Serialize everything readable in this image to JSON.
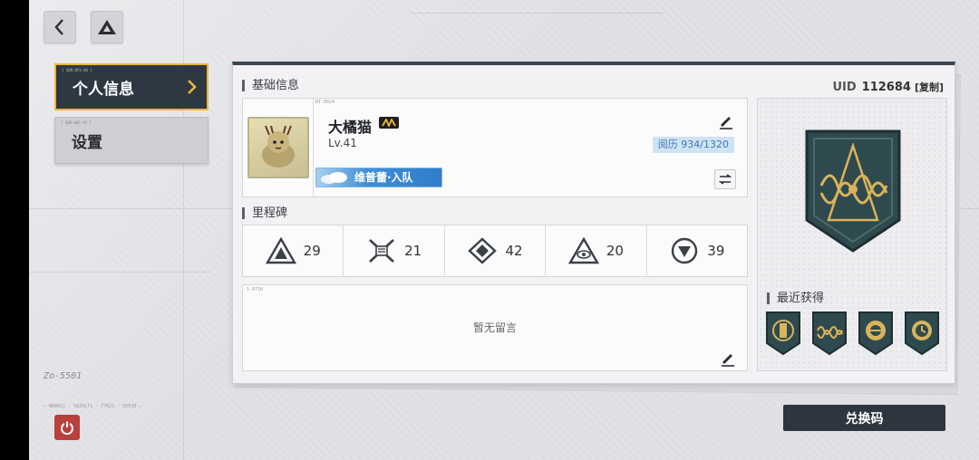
{
  "topbar": {
    "back_icon": "back-arrow-icon",
    "home_icon": "triangle-logo-icon"
  },
  "sidebar": {
    "items": [
      {
        "label": "个人信息",
        "code": "[ SUR-DP1-AO ]",
        "active": true
      },
      {
        "label": "设置",
        "code": "[ SUR-AO1-YG ]",
        "active": false
      }
    ],
    "power_icon": "power-icon",
    "deco_signature": "Zo-5501",
    "deco_code": "— N08011 · 5820171 · 77021 · 55038 —"
  },
  "profile": {
    "section_title": "基础信息",
    "uid_label": "UID",
    "uid_value": "112684",
    "copy_label": "[复制]",
    "card_code": "RT-0024",
    "nickname": "大橘猫",
    "level": "Lv.41",
    "exp": "阅历 934/1320",
    "team_name": "维普蕾·入队",
    "vip_icon": "vip-badge-icon",
    "edit_icon": "pencil-icon",
    "swap_icon": "swap-icon"
  },
  "milestones": {
    "section_title": "里程碑",
    "items": [
      {
        "icon": "milestone-triangle-icon",
        "value": "29"
      },
      {
        "icon": "milestone-cross-icon",
        "value": "21"
      },
      {
        "icon": "milestone-diamond-icon",
        "value": "42"
      },
      {
        "icon": "milestone-eye-icon",
        "value": "20"
      },
      {
        "icon": "milestone-circle-icon",
        "value": "39"
      }
    ]
  },
  "message": {
    "code": "1-0710",
    "empty_text": "暂无留言"
  },
  "medals": {
    "recent_title": "最近获得",
    "recent": [
      "medal-bust-icon",
      "medal-wave-icon",
      "medal-globe-icon",
      "medal-clock-icon"
    ],
    "colors": {
      "medal_dark": "#2f4a4e",
      "medal_gold": "#d9b45a"
    }
  },
  "redeem_label": "兑换码"
}
